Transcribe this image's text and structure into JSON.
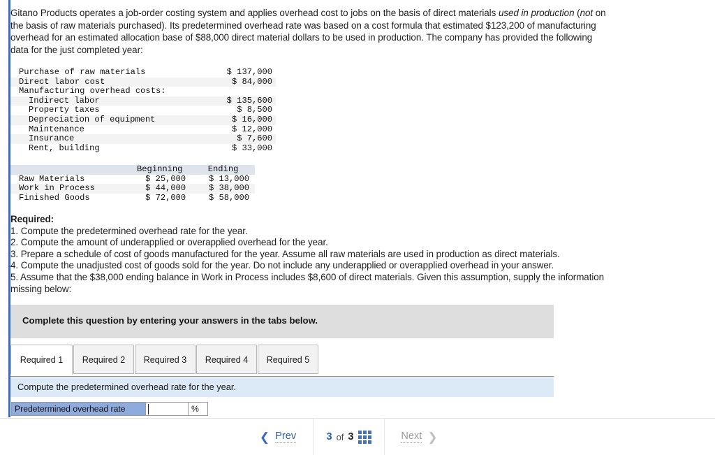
{
  "stem": {
    "part1": "Gitano Products operates a job-order costing system and applies overhead cost to jobs on the basis of direct materials ",
    "em1": "used in production",
    "part2": " (",
    "em2": "not",
    "part3": " on the basis of raw materials purchased). Its predetermined overhead rate was based on a cost formula that estimated $123,200 of manufacturing overhead for an estimated allocation base of $88,000 direct material dollars to be used in production. The company has provided the following data for the just completed year:"
  },
  "cost_table": {
    "rows": [
      {
        "label": "Purchase of raw materials",
        "value": "$ 137,000",
        "indent": false,
        "alt": false
      },
      {
        "label": "Direct labor cost",
        "value": "$ 84,000",
        "indent": false,
        "alt": true
      },
      {
        "label": "Manufacturing overhead costs:",
        "value": "",
        "indent": false,
        "alt": false
      },
      {
        "label": "Indirect labor",
        "value": "$ 135,600",
        "indent": true,
        "alt": true
      },
      {
        "label": "Property taxes",
        "value": "$ 8,500",
        "indent": true,
        "alt": false
      },
      {
        "label": "Depreciation of equipment",
        "value": "$ 16,000",
        "indent": true,
        "alt": true
      },
      {
        "label": "Maintenance",
        "value": "$ 12,000",
        "indent": true,
        "alt": false
      },
      {
        "label": "Insurance",
        "value": "$ 7,600",
        "indent": true,
        "alt": true
      },
      {
        "label": "Rent, building",
        "value": "$ 33,000",
        "indent": true,
        "alt": false
      }
    ]
  },
  "inventory_table": {
    "headers": {
      "blank": "",
      "beginning": "Beginning",
      "ending": "Ending"
    },
    "rows": [
      {
        "label": "Raw Materials",
        "beginning": "$ 25,000",
        "ending": "$ 13,000",
        "alt": false
      },
      {
        "label": "Work in Process",
        "beginning": "$ 44,000",
        "ending": "$ 38,000",
        "alt": true
      },
      {
        "label": "Finished Goods",
        "beginning": "$ 72,000",
        "ending": "$ 58,000",
        "alt": false
      }
    ]
  },
  "required": {
    "heading": "Required:",
    "items": [
      "1. Compute the predetermined overhead rate for the year.",
      "2. Compute the amount of underapplied or overapplied overhead for the year.",
      "3. Prepare a schedule of cost of goods manufactured for the year. Assume all raw materials are used in production as direct materials.",
      "4. Compute the unadjusted cost of goods sold for the year. Do not include any underapplied or overapplied overhead in your answer.",
      "5. Assume that the $38,000 ending balance in Work in Process includes $8,600 of direct materials. Given this assumption, supply the information missing below:"
    ]
  },
  "answer_panel": {
    "banner_text": "Complete this question by entering your answers in the tabs below.",
    "tabs": [
      {
        "label": "Required 1",
        "active": true
      },
      {
        "label": "Required 2",
        "active": false
      },
      {
        "label": "Required 3",
        "active": false
      },
      {
        "label": "Required 4",
        "active": false
      },
      {
        "label": "Required 5",
        "active": false
      }
    ],
    "tab_instruction": "Compute the predetermined overhead rate for the year.",
    "answer_row": {
      "label": "Predetermined overhead rate",
      "value": "",
      "unit": "%"
    }
  },
  "nav": {
    "prev_label": "Prev",
    "next_label": "Next",
    "current_page": "3",
    "of_label": "of",
    "total_pages": "3",
    "grid_icon": "grid-icon",
    "prev_icon": "chevron-left-icon",
    "next_icon": "chevron-right-icon"
  },
  "colors": {
    "rail": "#3a6bbf",
    "banner": "#dedede",
    "subbanner": "#dce9f7",
    "answer_label": "#8faadc",
    "accent": "#2b5fb0",
    "row_alt": "#f3f3f3",
    "table_header": "#dfe3ec"
  }
}
